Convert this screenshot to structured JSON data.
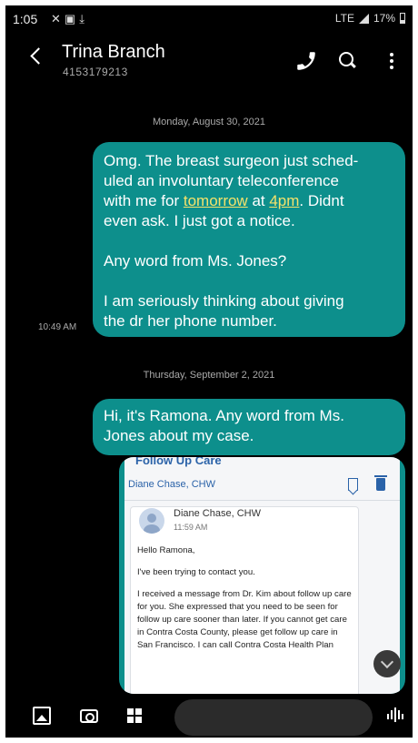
{
  "status_bar": {
    "time": "1:05",
    "left_icons": [
      "missed-call-icon",
      "image-notification-icon",
      "download-icon"
    ],
    "network": "LTE",
    "battery": "17%"
  },
  "header": {
    "contact_name": "Trina Branch",
    "contact_number": "4153179213",
    "icons": [
      "back-icon",
      "phone-icon",
      "search-icon",
      "more-icon"
    ]
  },
  "conversation": {
    "date_1": "Monday, August 30, 2021",
    "message_1": {
      "para_1_pre": "Omg.  The breast surgeon just sched-\nuled an involuntary teleconference\nwith me for ",
      "link_1": "tomorrow",
      "para_1_mid": " at ",
      "link_2": "4pm",
      "para_1_post": ". Didnt\neven ask.  I just got a notice.",
      "para_2": "Any word from Ms. Jones?",
      "para_3": "I am seriously thinking about giving\nthe dr her phone number.",
      "time": "10:49 AM"
    },
    "date_2": "Thursday, September 2, 2021",
    "message_2": {
      "text": "Hi, it's Ramona.  Any word from Ms.\nJones about my case."
    },
    "attachment": {
      "cut_title": "Follow Up Care",
      "sender_header": "Diane Chase, CHW",
      "from": "Diane Chase, CHW",
      "time": "11:59 AM",
      "greeting": "Hello Ramona,",
      "para_1": "I've been trying to contact you.",
      "para_2": "I received a message from Dr. Kim about follow up care for you. She expressed that you need to be seen for follow up care sooner than later. If you cannot get care in Contra Costa County, please get follow up care in San Francisco. I can call Contra Costa Health Plan"
    }
  },
  "toolbar": {
    "compose_placeholder": "",
    "icons": [
      "image-icon",
      "camera-icon",
      "apps-icon",
      "voice-icon"
    ]
  },
  "colors": {
    "bubble": "#0d8f8c",
    "link": "#f4e26b",
    "background": "#000000",
    "card_accent": "#2a62a8"
  }
}
